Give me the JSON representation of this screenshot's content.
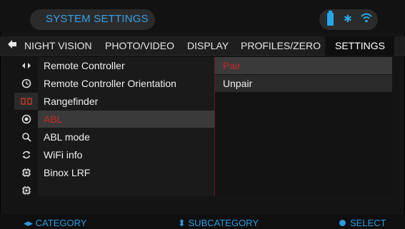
{
  "header": {
    "title": "SYSTEM SETTINGS",
    "icons": [
      "battery-icon",
      "bluetooth-icon",
      "wifi-icon"
    ],
    "accent_color": "#25a6ea"
  },
  "tabs": [
    {
      "label": "NIGHT VISION"
    },
    {
      "label": "PHOTO/VIDEO"
    },
    {
      "label": "DISPLAY"
    },
    {
      "label": "PROFILES/ZERO"
    },
    {
      "label": "SETTINGS",
      "active": true
    }
  ],
  "menu": {
    "items": [
      {
        "label": "Remote Controller",
        "icon": "remote-arrows-icon"
      },
      {
        "label": "Remote Controller Orientation",
        "icon": "clock-icon"
      },
      {
        "label": "Rangefinder",
        "icon": "rangefinder-icon"
      },
      {
        "label": "ABL",
        "icon": "target-icon",
        "selected": true
      },
      {
        "label": "ABL mode",
        "icon": "search-icon"
      },
      {
        "label": "WiFi info",
        "icon": "refresh-icon"
      },
      {
        "label": "Binox LRF",
        "icon": "chip-icon"
      },
      {
        "label": "",
        "icon": "chip-icon"
      }
    ],
    "selected_color": "#c62828"
  },
  "submenu": {
    "items": [
      {
        "label": "Pair",
        "selected": true
      },
      {
        "label": "Unpair"
      }
    ]
  },
  "footer": {
    "category": "CATEGORY",
    "subcategory": "SUBCATEGORY",
    "select": "SELECT"
  }
}
